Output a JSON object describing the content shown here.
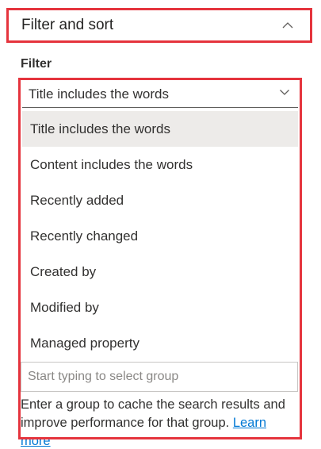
{
  "section": {
    "title": "Filter and sort",
    "toggle_icon": "chevron-up-icon"
  },
  "filter": {
    "label": "Filter",
    "selected_value": "Title includes the words",
    "dropdown_icon": "chevron-down-icon",
    "options": [
      {
        "label": "Title includes the words",
        "selected": true
      },
      {
        "label": "Content includes the words",
        "selected": false
      },
      {
        "label": "Recently added",
        "selected": false
      },
      {
        "label": "Recently changed",
        "selected": false
      },
      {
        "label": "Created by",
        "selected": false
      },
      {
        "label": "Modified by",
        "selected": false
      },
      {
        "label": "Managed property",
        "selected": false
      }
    ]
  },
  "group": {
    "placeholder": "Start typing to select group",
    "help_text": "Enter a group to cache the search results and improve performance for that group.",
    "link_text_1": "Learn",
    "link_text_2": "more"
  },
  "colors": {
    "highlight": "#e5343d",
    "link": "#0078d4",
    "selected_bg": "#edebe9"
  }
}
